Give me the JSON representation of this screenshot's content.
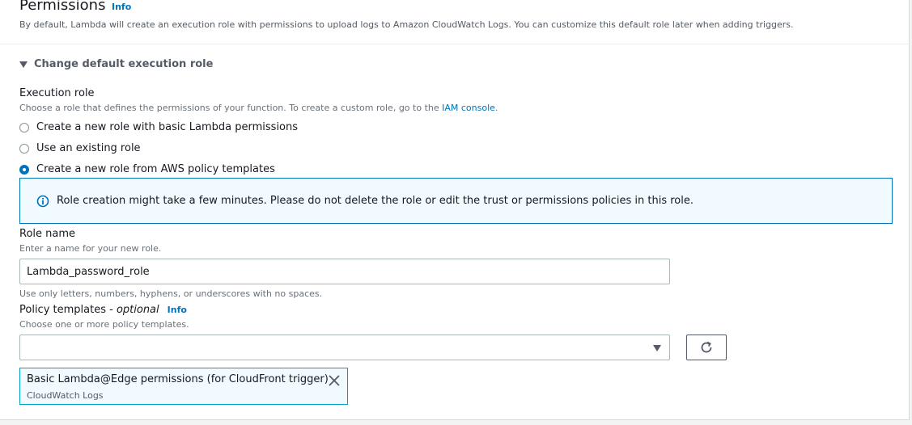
{
  "header": {
    "title": "Permissions",
    "info": "Info",
    "description": "By default, Lambda will create an execution role with permissions to upload logs to Amazon CloudWatch Logs. You can customize this default role later when adding triggers."
  },
  "expander": {
    "label": "Change default execution role"
  },
  "execution_role": {
    "label": "Execution role",
    "description_prefix": "Choose a role that defines the permissions of your function. To create a custom role, go to the ",
    "description_link": "IAM console",
    "description_suffix": ".",
    "options": [
      {
        "label": "Create a new role with basic Lambda permissions",
        "checked": false
      },
      {
        "label": "Use an existing role",
        "checked": false
      },
      {
        "label": "Create a new role from AWS policy templates",
        "checked": true
      }
    ]
  },
  "alert": {
    "text": "Role creation might take a few minutes. Please do not delete the role or edit the trust or permissions policies in this role.",
    "icon": "info-circle-icon"
  },
  "role_name": {
    "label": "Role name",
    "description": "Enter a name for your new role.",
    "value": "Lambda_password_role",
    "constraint": "Use only letters, numbers, hyphens, or underscores with no spaces."
  },
  "policy_templates": {
    "label": "Policy templates - ",
    "optional": "optional",
    "info": "Info",
    "description": "Choose one or more policy templates.",
    "selected_value": "",
    "tokens": [
      {
        "label": "Basic Lambda@Edge permissions (for CloudFront trigger)",
        "sublabel": "CloudWatch Logs"
      }
    ]
  },
  "colors": {
    "link": "#0073bb",
    "alert_border": "#0073bb",
    "alert_bg": "#f1faff",
    "token_border": "#00a1c9"
  }
}
